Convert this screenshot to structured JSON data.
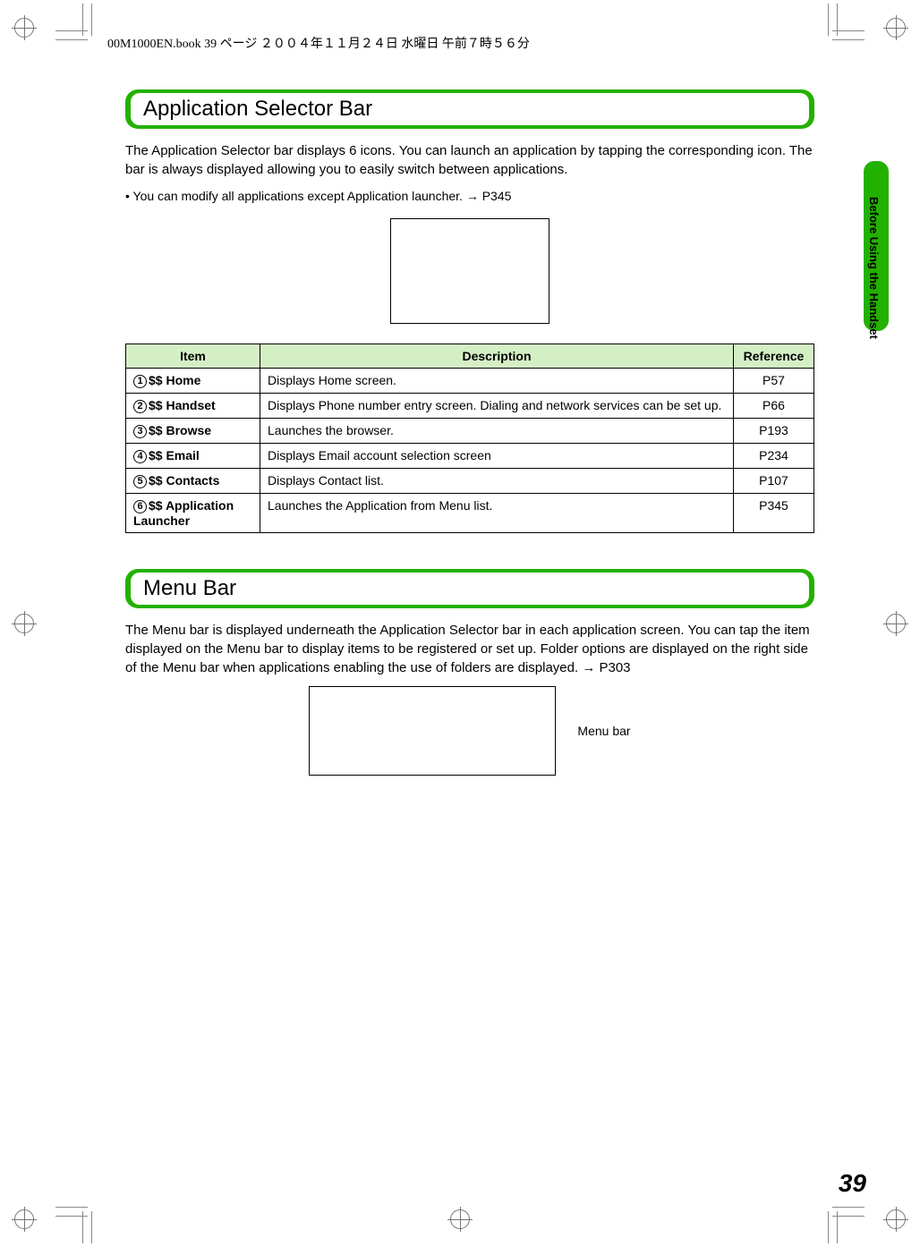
{
  "header_line": "00M1000EN.book  39 ページ  ２００４年１１月２４日  水曜日  午前７時５６分",
  "side_label": "Before Using the Handset",
  "page_number": "39",
  "section1": {
    "title": "Application Selector Bar",
    "para": "The Application Selector bar displays 6 icons. You can launch an application by tapping the corresponding icon. The bar is always displayed allowing you to easily switch between applications.",
    "bullet": "You can modify all applications except Application launcher. → P345",
    "table": {
      "headers": {
        "item": "Item",
        "desc": "Description",
        "ref": "Reference"
      },
      "rows": [
        {
          "n": "1",
          "item": "$$ Home",
          "desc": "Displays Home screen.",
          "ref": "P57"
        },
        {
          "n": "2",
          "item": "$$ Handset",
          "desc": "Displays Phone number entry screen. Dialing and network services can be set up.",
          "ref": "P66"
        },
        {
          "n": "3",
          "item": "$$ Browse",
          "desc": "Launches the browser.",
          "ref": "P193"
        },
        {
          "n": "4",
          "item": "$$ Email",
          "desc": "Displays Email account selection screen",
          "ref": "P234"
        },
        {
          "n": "5",
          "item": "$$ Contacts",
          "desc": "Displays Contact list.",
          "ref": "P107"
        },
        {
          "n": "6",
          "item": "$$ Application Launcher",
          "desc": "Launches the Application from Menu list.",
          "ref": "P345"
        }
      ]
    }
  },
  "section2": {
    "title": "Menu Bar",
    "para": "The Menu bar is displayed underneath the Application Selector bar in each application screen. You can tap the item displayed on the Menu bar to display items to be registered or set up. Folder options are displayed on the right side of the Menu bar when applications enabling the use of folders are displayed. → P303",
    "caption": "Menu bar"
  }
}
